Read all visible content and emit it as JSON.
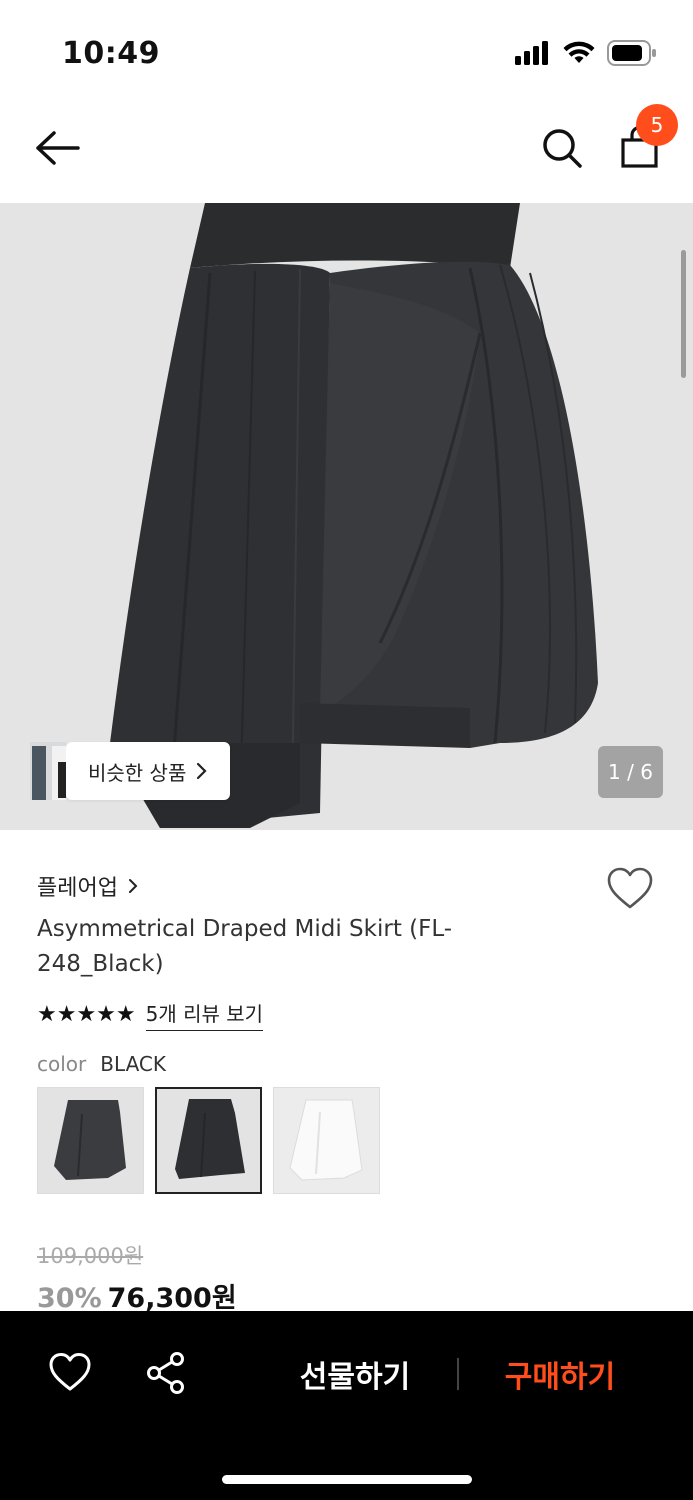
{
  "status_bar": {
    "time": "10:49"
  },
  "header": {
    "cart_count": "5"
  },
  "image": {
    "counter": "1 / 6",
    "similar_label": "비슷한 상품"
  },
  "product": {
    "brand": "플레어업",
    "name": "Asymmetrical Draped Midi Skirt (FL-248_Black)",
    "stars": "★★★★★",
    "review_link": "5개 리뷰 보기",
    "color_label": "color",
    "color_value": "BLACK",
    "swatches": [
      "black-1",
      "black-2",
      "white"
    ],
    "selected_swatch": 1
  },
  "price": {
    "original": "109,000원",
    "discount": "30%",
    "sale": "76,300원"
  },
  "bottom_bar": {
    "gift_label": "선물하기",
    "buy_label": "구매하기"
  },
  "colors": {
    "accent": "#ff4e1c",
    "badge": "#ff4e1c",
    "bottom_bar_bg": "#000000"
  }
}
